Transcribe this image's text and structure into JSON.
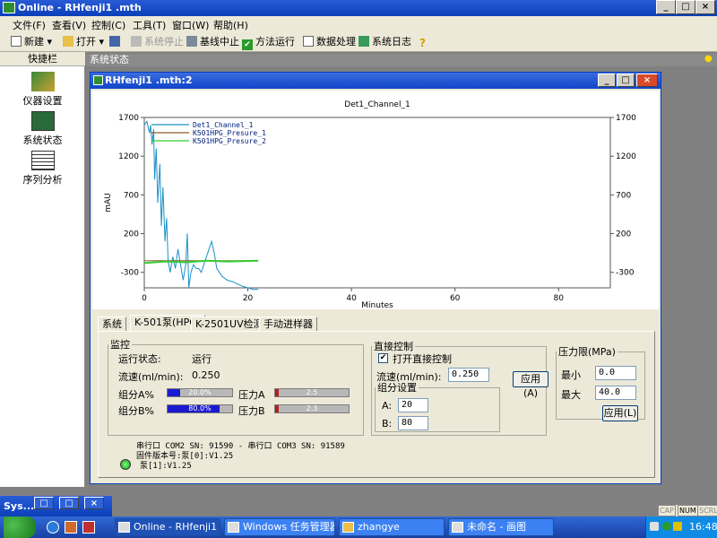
{
  "app": {
    "title": "Online - RHfenji1 .mth"
  },
  "window_buttons": {
    "min": "_",
    "max": "□",
    "close": "×"
  },
  "menu": [
    "文件(F)",
    "查看(V)",
    "控制(C)",
    "工具(T)",
    "窗口(W)",
    "帮助(H)"
  ],
  "toolbar": {
    "new": "新建",
    "open": "打开",
    "stop": "系统停止",
    "baseline": "基线中止",
    "run": "方法运行",
    "data": "数据处理",
    "log": "系统日志"
  },
  "leftpanel": {
    "header": "快捷栏",
    "items": [
      "仪器设置",
      "系统状态",
      "序列分析"
    ]
  },
  "status_header": "系统状态",
  "child": {
    "title": "RHfenji1 .mth:2"
  },
  "chart_data": {
    "type": "line",
    "title": "Det1_Channel_1",
    "xlabel": "Minutes",
    "ylabel": "mAU",
    "xlim": [
      0,
      90
    ],
    "ylim": [
      -500,
      1700
    ],
    "xticks": [
      0,
      20,
      40,
      60,
      80
    ],
    "yticks": [
      1700,
      1200,
      700,
      200,
      -300
    ],
    "legend": "top-left",
    "series": [
      {
        "name": "Det1_Channel_1",
        "color": "#1a8fc8",
        "x": [
          0,
          0.5,
          1,
          1.2,
          1.5,
          1.8,
          2,
          2.3,
          2.6,
          3,
          3.3,
          3.6,
          4,
          4.3,
          4.6,
          5,
          5.5,
          6,
          6.5,
          7,
          7.5,
          8,
          8.3,
          8.6,
          9,
          9.5,
          10,
          10.5,
          11,
          11.5,
          12,
          12.5,
          13,
          13.5,
          14,
          14.5,
          15,
          16,
          17,
          18,
          19,
          20,
          21,
          22
        ],
        "y": [
          1600,
          1650,
          1500,
          1600,
          1350,
          1550,
          900,
          1300,
          600,
          1100,
          300,
          800,
          100,
          400,
          -150,
          -300,
          -100,
          -250,
          0,
          -200,
          -400,
          -200,
          200,
          -500,
          -300,
          -200,
          -250,
          -250,
          -300,
          -200,
          -100,
          0,
          100,
          -50,
          -250,
          -300,
          -350,
          -400,
          -420,
          -450,
          -480,
          -500,
          -520,
          -520
        ]
      },
      {
        "name": "K501HPG_Presure_1",
        "color": "#8b5a2b",
        "x": [
          0,
          22
        ],
        "y": [
          -150,
          -150
        ]
      },
      {
        "name": "K501HPG_Presure_2",
        "color": "#33cc33",
        "x": [
          0,
          4,
          8,
          12,
          16,
          22
        ],
        "y": [
          -180,
          -160,
          -170,
          -150,
          -160,
          -150
        ]
      }
    ]
  },
  "tabs": [
    "系统",
    "K-501泵(HPG)",
    "K-2501UV检测器",
    "手动进样器"
  ],
  "monitor": {
    "legend": "监控",
    "run_status_label": "运行状态:",
    "run_status_value": "运行",
    "flow_label": "流速(ml/min):",
    "flow_value": "0.250",
    "compA_label": "组分A%",
    "compA_text": "20.0%",
    "compA_pct": 20,
    "compB_label": "组分B%",
    "compB_text": "80.0%",
    "compB_pct": 80,
    "pressA_label": "压力A",
    "pressA_text": "2.5",
    "pressB_label": "压力B",
    "pressB_text": "2.3"
  },
  "direct": {
    "legend": "直接控制",
    "enable_label": "打开直接控制",
    "flow_label": "流速(ml/min):",
    "flow_value": "0.250",
    "apply_label": "应用(A)",
    "comp_legend": "组分设置",
    "a_label": "A:",
    "a_value": "20",
    "b_label": "B:",
    "b_value": "80"
  },
  "pressure_limit": {
    "legend": "压力限(MPa)",
    "min_label": "最小",
    "min_value": "0.0",
    "max_label": "最大",
    "max_value": "40.0",
    "apply_label": "应用(L)"
  },
  "serial": {
    "line1": "串行口 COM2 SN: 91590 - 串行口 COM3 SN: 91589",
    "line2": "固件版本号:泵[0]:V1.25",
    "line3": "泵[1]:V1.25"
  },
  "statusbar": {
    "cap": "CAP",
    "num": "NUM",
    "scrl": "SCRL"
  },
  "sysmini": "Sys...",
  "taskbar": {
    "tasks": [
      "Online - RHfenji1 .mth",
      "Windows 任务管理器",
      "zhangye",
      "未命名 - 画图"
    ],
    "time": "16:48"
  }
}
